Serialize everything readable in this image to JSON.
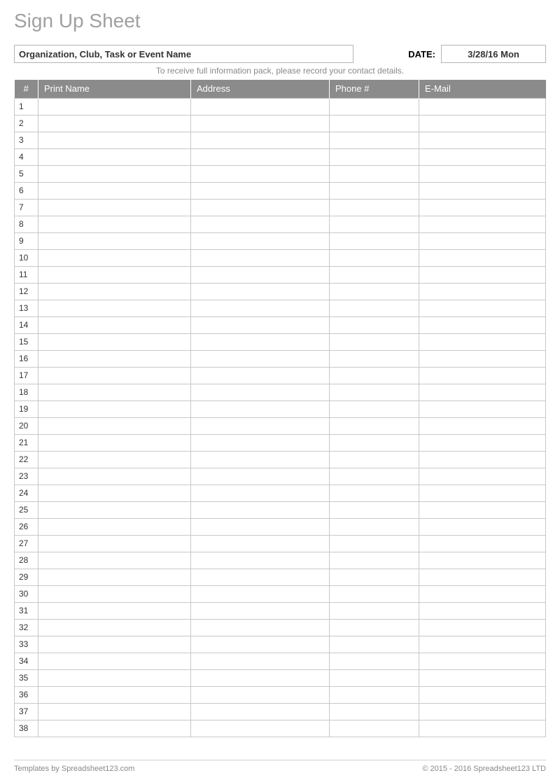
{
  "title": "Sign Up Sheet",
  "org_placeholder": "Organization, Club, Task or Event Name",
  "date_label": "DATE:",
  "date_value": "3/28/16 Mon",
  "subtitle": "To receive full information pack, please record your contact details.",
  "columns": {
    "num": "#",
    "name": "Print Name",
    "address": "Address",
    "phone": "Phone #",
    "email": "E-Mail"
  },
  "row_count": 38,
  "footer": {
    "left": "Templates by Spreadsheet123.com",
    "right": "© 2015 - 2016 Spreadsheet123 LTD"
  }
}
